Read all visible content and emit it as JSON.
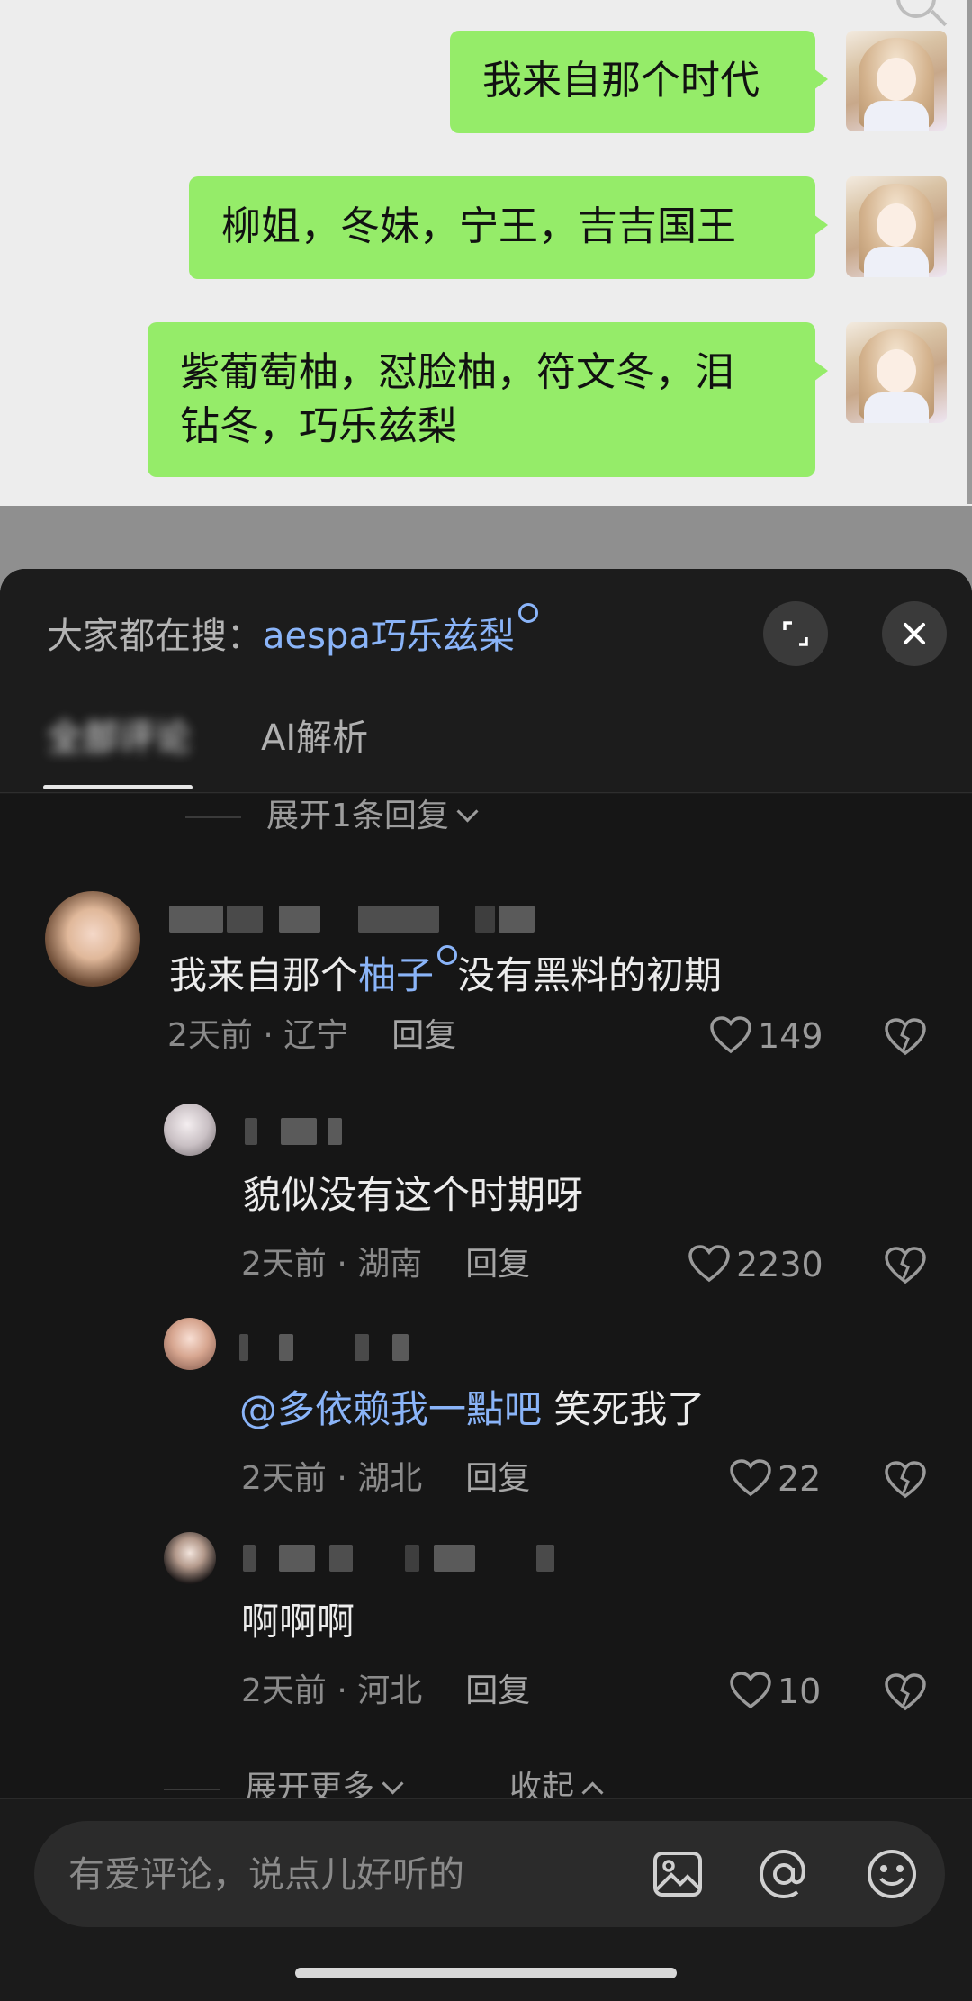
{
  "chat": {
    "messages": [
      {
        "text": "我来自那个时代"
      },
      {
        "text": "柳姐，冬妹，宁王，吉吉国王"
      },
      {
        "text_line1": "紫葡萄柚，怼脸柚，符文冬，泪",
        "text_line2": "钻冬，巧乐兹梨"
      }
    ]
  },
  "sheet": {
    "trending_label": "大家都在搜：",
    "trending_keyword": "aespa巧乐兹梨",
    "tabs": {
      "comments": "全部评论",
      "ai": "AI解析"
    },
    "expand_reply": "展开1条回复",
    "expand_more": "展开更多",
    "collapse": "收起"
  },
  "comments": [
    {
      "text_before": "我来自那个",
      "keyword": "柚子",
      "text_after": "没有黑料的初期",
      "time": "2天前",
      "location": "辽宁",
      "reply": "回复",
      "likes": "149"
    },
    {
      "text": "貌似没有这个时期呀",
      "time": "2天前",
      "location": "湖南",
      "reply": "回复",
      "likes": "2230"
    },
    {
      "mention": "@多依赖我一點吧",
      "text": " 笑死我了",
      "time": "2天前",
      "location": "湖北",
      "reply": "回复",
      "likes": "22"
    },
    {
      "text": "啊啊啊",
      "time": "2天前",
      "location": "河北",
      "reply": "回复",
      "likes": "10"
    }
  ],
  "input": {
    "placeholder": "有爱评论，说点儿好听的"
  },
  "icons": [
    "search-icon",
    "expand-icon",
    "close-icon",
    "heart-icon",
    "dislike-icon",
    "image-icon",
    "at-icon",
    "emoji-icon",
    "chevron-down-icon",
    "chevron-up-icon"
  ],
  "colors": {
    "bubble": "#95ec69",
    "link": "#8ab4f8",
    "sheet_bg": "#161616"
  }
}
